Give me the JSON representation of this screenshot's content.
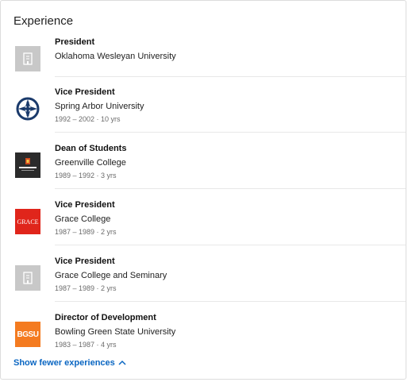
{
  "section": {
    "heading": "Experience",
    "show_fewer_label": "Show fewer experiences"
  },
  "entries": [
    {
      "title": "President",
      "company": "Oklahoma Wesleyan University",
      "dates": "",
      "logo": "placeholder-building-icon"
    },
    {
      "title": "Vice President",
      "company": "Spring Arbor University",
      "dates": "1992 – 2002 · 10 yrs",
      "logo": "spring-arbor-logo"
    },
    {
      "title": "Dean of Students",
      "company": "Greenville College",
      "dates": "1989 – 1992 · 3 yrs",
      "logo": "greenville-logo"
    },
    {
      "title": "Vice President",
      "company": "Grace College",
      "dates": "1987 – 1989 · 2 yrs",
      "logo": "grace-logo",
      "logo_text": "GRACE"
    },
    {
      "title": "Vice President",
      "company": "Grace College and Seminary",
      "dates": "1987 – 1989 · 2 yrs",
      "logo": "placeholder-building-icon"
    },
    {
      "title": "Director of Development",
      "company": "Bowling Green State University",
      "dates": "1983 – 1987 · 4 yrs",
      "logo": "bgsu-logo",
      "logo_text": "BGSU"
    }
  ],
  "colors": {
    "link": "#0a66c2",
    "bgsu": "#f47b20",
    "grace": "#e0251b",
    "spring_arbor": "#1a3a6b"
  }
}
